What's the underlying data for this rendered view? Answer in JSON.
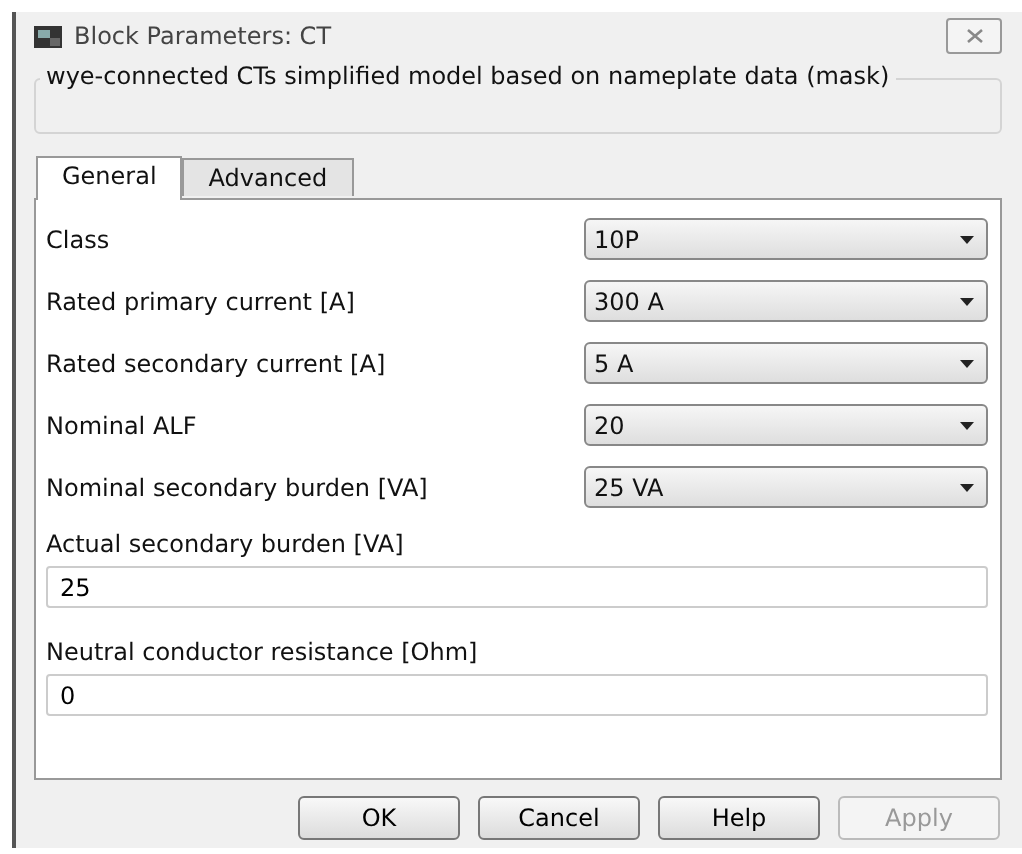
{
  "window": {
    "title": "Block Parameters: CT"
  },
  "description": "wye-connected CTs simplified model based on nameplate data (mask)",
  "tabs": [
    {
      "label": "General",
      "selected": true
    },
    {
      "label": "Advanced",
      "selected": false
    }
  ],
  "parameters": [
    {
      "kind": "dropdown",
      "label": "Class",
      "value": "10P"
    },
    {
      "kind": "dropdown",
      "label": "Rated primary current [A]",
      "value": "300 A"
    },
    {
      "kind": "dropdown",
      "label": "Rated secondary current [A]",
      "value": "5 A"
    },
    {
      "kind": "dropdown",
      "label": "Nominal ALF",
      "value": "20"
    },
    {
      "kind": "dropdown",
      "label": "Nominal secondary burden [VA]",
      "value": "25 VA"
    },
    {
      "kind": "edit",
      "label": "Actual secondary burden [VA]",
      "value": "25"
    },
    {
      "kind": "edit",
      "label": "Neutral conductor resistance [Ohm]",
      "value": "0"
    }
  ],
  "buttons": [
    {
      "label": "OK",
      "disabled": false
    },
    {
      "label": "Cancel",
      "disabled": false
    },
    {
      "label": "Help",
      "disabled": false
    },
    {
      "label": "Apply",
      "disabled": true
    }
  ]
}
